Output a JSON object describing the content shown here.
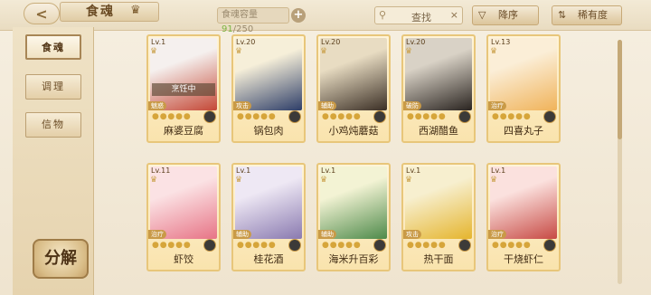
{
  "header": {
    "back_label": "<",
    "title": "食魂",
    "capacity_label": "食魂容量",
    "capacity_current": "91",
    "capacity_total": "/250",
    "capacity_add": "+",
    "search_placeholder": "查找",
    "search_clear": "×",
    "sort_label": "降序",
    "sort_icon": "▽",
    "filter_label": "稀有度",
    "filter_icon": "⇅"
  },
  "sidebar": {
    "tabs": [
      {
        "label": "食魂",
        "active": true
      },
      {
        "label": "调理",
        "active": false
      },
      {
        "label": "信物",
        "active": false
      }
    ],
    "decompose_label": "分解"
  },
  "cards": [
    {
      "level": "Lv.1",
      "name": "麻婆豆腐",
      "role": "魅惑",
      "status": "烹饪中",
      "colors": [
        "#f5f0ee",
        "#c44836"
      ]
    },
    {
      "level": "Lv.20",
      "name": "锅包肉",
      "role": "攻击",
      "status": "",
      "colors": [
        "#f6efd9",
        "#2e3e68"
      ]
    },
    {
      "level": "Lv.20",
      "name": "小鸡炖蘑菇",
      "role": "辅助",
      "status": "",
      "colors": [
        "#e8dcc2",
        "#3b2f25"
      ]
    },
    {
      "level": "Lv.20",
      "name": "西湖醋鱼",
      "role": "破防",
      "status": "",
      "colors": [
        "#d9d2c6",
        "#2a2420"
      ]
    },
    {
      "level": "Lv.13",
      "name": "四喜丸子",
      "role": "治疗",
      "status": "",
      "colors": [
        "#fbeed7",
        "#f0b35a"
      ]
    },
    {
      "level": "Lv.11",
      "name": "虾饺",
      "role": "治疗",
      "status": "",
      "colors": [
        "#fbe2e4",
        "#e77486"
      ]
    },
    {
      "level": "Lv.1",
      "name": "桂花酒",
      "role": "辅助",
      "status": "",
      "colors": [
        "#eee8f4",
        "#8a7ab0"
      ]
    },
    {
      "level": "Lv.1",
      "name": "海米升百彩",
      "role": "辅助",
      "status": "",
      "colors": [
        "#f3f3d4",
        "#4e8a4a"
      ]
    },
    {
      "level": "Lv.1",
      "name": "热干面",
      "role": "攻击",
      "status": "",
      "colors": [
        "#f7efcf",
        "#e5b52e"
      ]
    },
    {
      "level": "Lv.1",
      "name": "干烧虾仁",
      "role": "治疗",
      "status": "",
      "colors": [
        "#fbe1de",
        "#c74a44"
      ]
    }
  ],
  "icons": {
    "star": "●",
    "search": "⚲",
    "hat": "♛"
  }
}
